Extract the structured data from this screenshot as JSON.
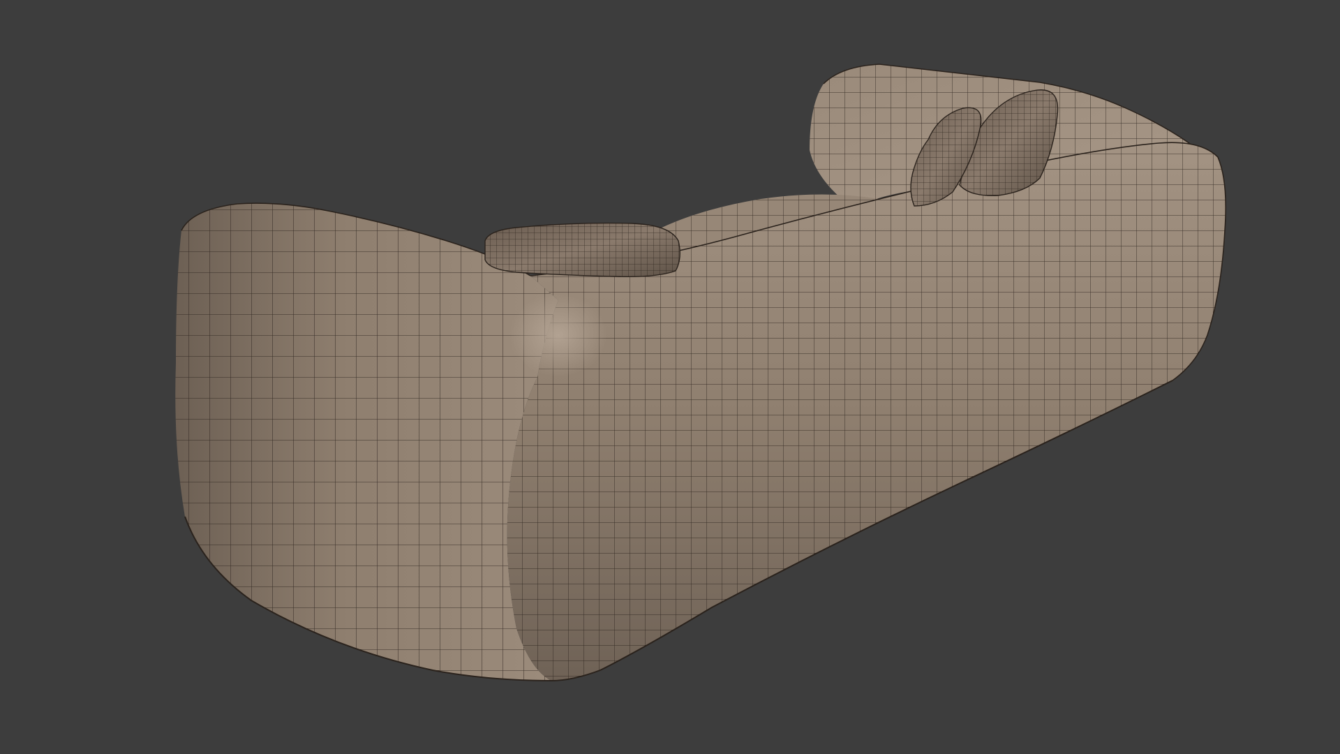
{
  "viewport": {
    "subject": "sofa-mesh",
    "background_color": "#3d3d3d",
    "mesh_base_color": "#8f7f6f",
    "mesh_light_color": "#a39383",
    "mesh_dark_color": "#5c5046",
    "wire_color": "#2a221c",
    "pillow_color": "#7e6e61",
    "display_mode": "shaded-wireframe"
  }
}
